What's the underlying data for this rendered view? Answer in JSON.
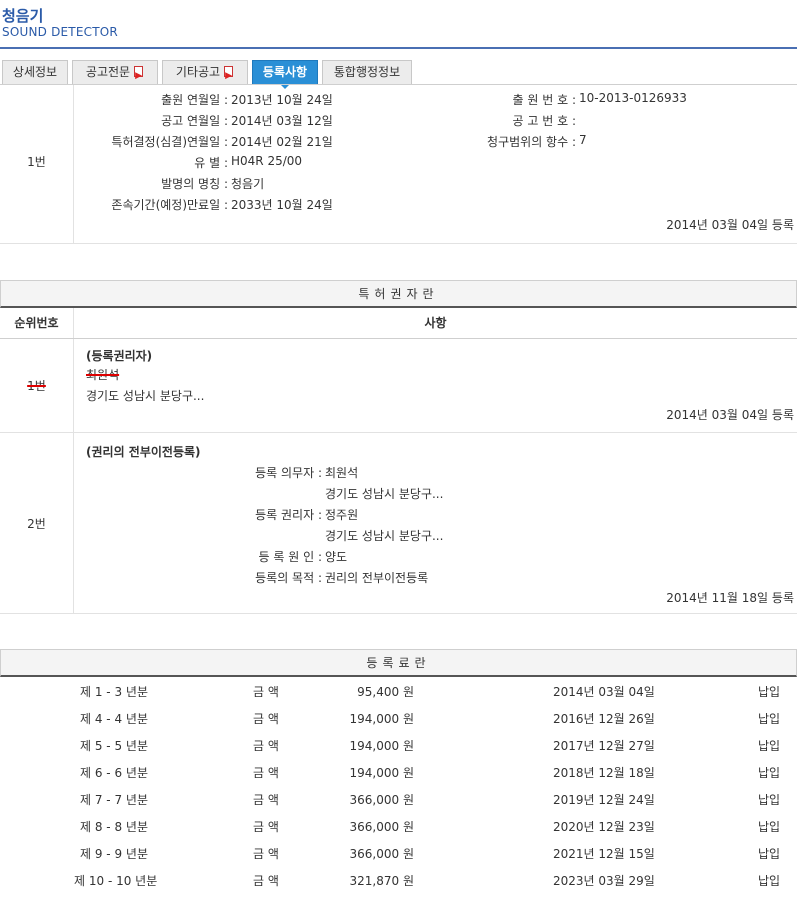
{
  "header": {
    "title": "청음기",
    "subtitle": "SOUND DETECTOR"
  },
  "tabs": [
    {
      "label": "상세정보",
      "pdf": false
    },
    {
      "label": "공고전문",
      "pdf": true
    },
    {
      "label": "기타공고",
      "pdf": true
    },
    {
      "label": "등록사항",
      "pdf": false
    },
    {
      "label": "통합행정정보",
      "pdf": false
    }
  ],
  "basic": {
    "index": "1번",
    "left": [
      {
        "label": "출원 연월일 :",
        "value": "2013년 10월 24일"
      },
      {
        "label": "공고 연월일 :",
        "value": "2014년 03월 12일"
      },
      {
        "label": "특허결정(심결)연월일 :",
        "value": "2014년 02월 21일"
      },
      {
        "label": "유 별 :",
        "value": "H04R 25/00"
      },
      {
        "label": "발명의 명칭 :",
        "value": "청음기"
      },
      {
        "label": "존속기간(예정)만료일 :",
        "value": "2033년 10월 24일"
      }
    ],
    "right": [
      {
        "label": "출 원 번 호 :",
        "value": "10-2013-0126933"
      },
      {
        "label": "공 고 번 호 :",
        "value": ""
      },
      {
        "label": "청구범위의 항수 :",
        "value": "7"
      }
    ],
    "registered": "2014년 03월 04일 등록"
  },
  "owner_section": {
    "title": "특허권자란",
    "col_index": "순위번호",
    "col_detail": "사항",
    "entry1": {
      "index": "1번",
      "heading": "(등록권리자)",
      "name": "최원석",
      "address": "경기도 성남시 분당구...",
      "date": "2014년 03월 04일 등록"
    },
    "entry2": {
      "index": "2번",
      "heading": "(권리의 전부이전등록)",
      "lines": [
        {
          "label": "등록 의무자 :",
          "value": "최원석"
        },
        {
          "label": "",
          "value": "경기도 성남시 분당구..."
        },
        {
          "label": "등록 권리자 :",
          "value": "정주원"
        },
        {
          "label": "",
          "value": "경기도 성남시 분당구..."
        },
        {
          "label": "등 록 원 인 :",
          "value": "양도"
        },
        {
          "label": "등록의 목적 :",
          "value": "권리의 전부이전등록"
        }
      ],
      "date": "2014년 11월 18일 등록"
    }
  },
  "fee_section": {
    "title": "등록료란",
    "rows": [
      {
        "period": "제 1 - 3 년분",
        "label": "금 액",
        "amount": "95,400 원",
        "date": "2014년 03월 04일",
        "status": "납입"
      },
      {
        "period": "제 4 - 4 년분",
        "label": "금 액",
        "amount": "194,000 원",
        "date": "2016년 12월 26일",
        "status": "납입"
      },
      {
        "period": "제 5 - 5 년분",
        "label": "금 액",
        "amount": "194,000 원",
        "date": "2017년 12월 27일",
        "status": "납입"
      },
      {
        "period": "제 6 - 6 년분",
        "label": "금 액",
        "amount": "194,000 원",
        "date": "2018년 12월 18일",
        "status": "납입"
      },
      {
        "period": "제 7 - 7 년분",
        "label": "금 액",
        "amount": "366,000 원",
        "date": "2019년 12월 24일",
        "status": "납입"
      },
      {
        "period": "제 8 - 8 년분",
        "label": "금 액",
        "amount": "366,000 원",
        "date": "2020년 12월 23일",
        "status": "납입"
      },
      {
        "period": "제 9 - 9 년분",
        "label": "금 액",
        "amount": "366,000 원",
        "date": "2021년 12월 15일",
        "status": "납입"
      },
      {
        "period": "제 10 - 10 년분",
        "label": "금 액",
        "amount": "321,870 원",
        "date": "2023년 03월 29일",
        "status": "납입"
      }
    ]
  }
}
